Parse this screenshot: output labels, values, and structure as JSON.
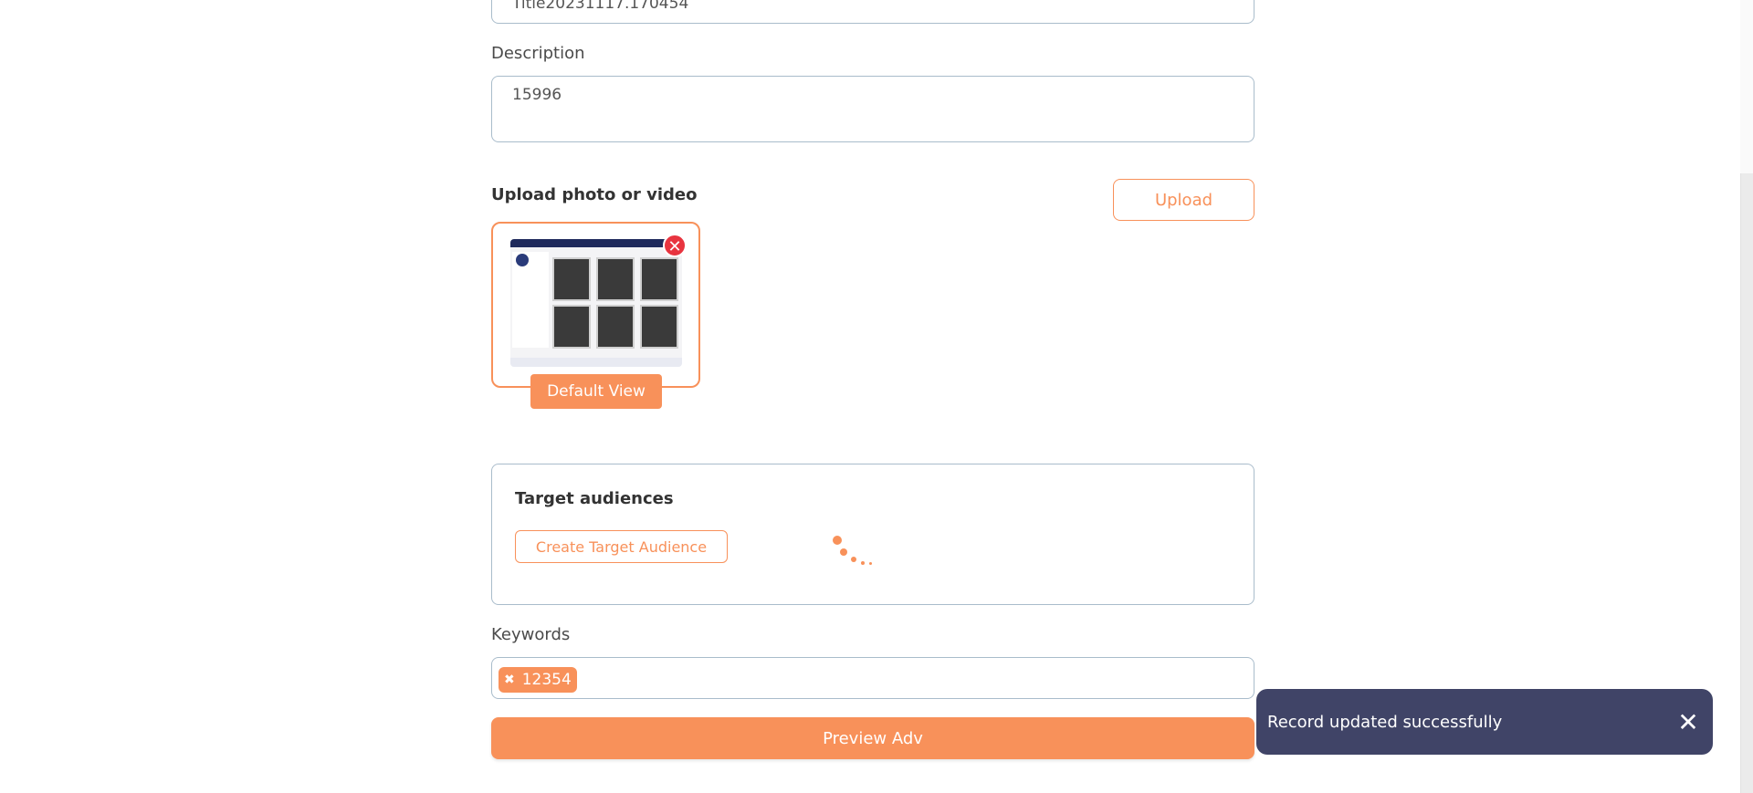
{
  "title_field": {
    "value": "Title20231117.170454"
  },
  "description": {
    "label": "Description",
    "value": "15996"
  },
  "upload": {
    "title": "Upload photo or video",
    "button_label": "Upload",
    "remove_icon": "close-icon",
    "default_view_label": "Default View"
  },
  "target": {
    "title": "Target audiences",
    "create_label": "Create Target Audience"
  },
  "keywords": {
    "label": "Keywords",
    "chips": [
      {
        "label": "12354"
      }
    ]
  },
  "preview": {
    "label": "Preview Adv"
  },
  "toast": {
    "message": "Record updated successfully",
    "close_icon": "close-icon"
  },
  "colors": {
    "accent": "#f8915a",
    "toast": "#404467",
    "danger": "#e8343f",
    "border": "#a9bccb"
  }
}
